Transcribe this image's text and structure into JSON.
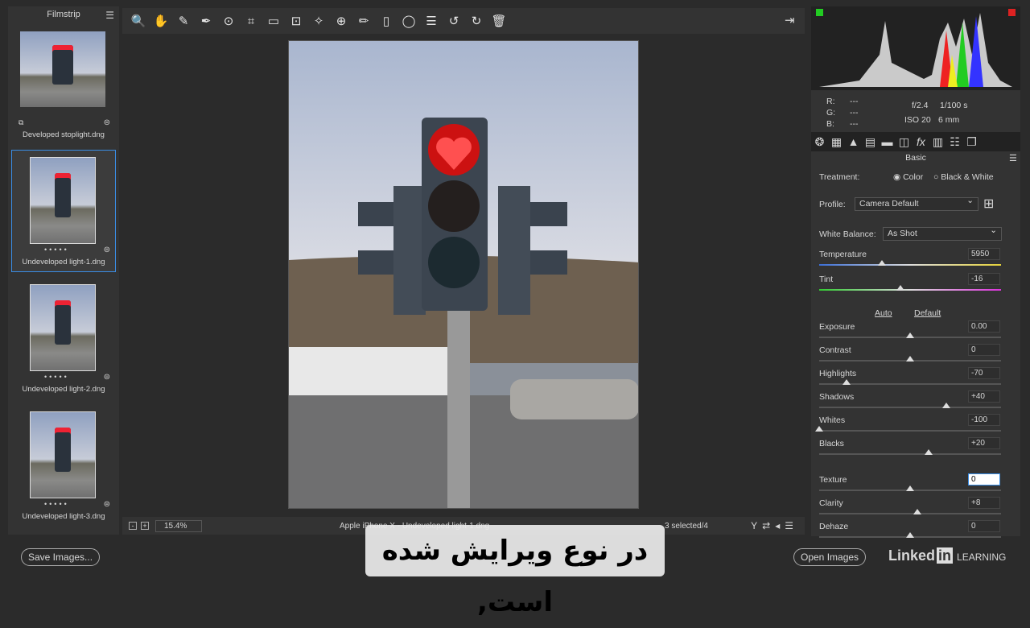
{
  "filmstrip": {
    "title": "Filmstrip",
    "items": [
      {
        "name": "Developed stoplight.dng",
        "selected": false
      },
      {
        "name": "Undeveloped light-1.dng",
        "selected": true
      },
      {
        "name": "Undeveloped light-2.dng",
        "selected": false
      },
      {
        "name": "Undeveloped light-3.dng",
        "selected": false
      }
    ]
  },
  "toolbar": {
    "tools": [
      "zoom-icon",
      "hand-icon",
      "white-balance-icon",
      "color-sampler-icon",
      "targeted-adjustment-icon",
      "crop-icon",
      "straighten-icon",
      "transform-icon",
      "spot-removal-icon",
      "red-eye-icon",
      "adjustment-brush-icon",
      "graduated-filter-icon",
      "radial-filter-icon",
      "presets-list-icon",
      "rotate-left-icon",
      "rotate-right-icon",
      "trash-icon"
    ],
    "glyphs": [
      "🔍",
      "✋",
      "✎",
      "✒",
      "⊙",
      "⌗",
      "▭",
      "⊡",
      "✧",
      "⊕",
      "✏",
      "▯",
      "◯",
      "☰",
      "↺",
      "↻",
      "🗑"
    ]
  },
  "status": {
    "zoom": "15.4%",
    "filename": "Apple iPhone X  -  Undeveloped light-1.dng",
    "selected": "3 selected/4"
  },
  "info": {
    "r_label": "R:",
    "g_label": "G:",
    "b_label": "B:",
    "r": "---",
    "g": "---",
    "b": "---",
    "aperture": "f/2.4",
    "shutter": "1/100 s",
    "iso": "ISO 20",
    "focal": "6 mm"
  },
  "panel": {
    "title": "Basic",
    "treatment_label": "Treatment:",
    "color": "Color",
    "bw": "Black & White",
    "treatment_value": "Color",
    "profile_label": "Profile:",
    "profile": "Camera Default",
    "wb_label": "White Balance:",
    "wb": "As Shot",
    "auto": "Auto",
    "default": "Default"
  },
  "sliders": [
    {
      "label": "Temperature",
      "value": "5950",
      "num": 5950,
      "min": 2000,
      "max": 50000
    },
    {
      "label": "Tint",
      "value": "-16",
      "num": -16,
      "min": -150,
      "max": 150
    },
    {
      "label": "Exposure",
      "value": "0.00",
      "num": 0,
      "min": -5,
      "max": 5
    },
    {
      "label": "Contrast",
      "value": "0",
      "num": 0,
      "min": -100,
      "max": 100
    },
    {
      "label": "Highlights",
      "value": "-70",
      "num": -70,
      "min": -100,
      "max": 100
    },
    {
      "label": "Shadows",
      "value": "+40",
      "num": 40,
      "min": -100,
      "max": 100
    },
    {
      "label": "Whites",
      "value": "-100",
      "num": -100,
      "min": -100,
      "max": 100
    },
    {
      "label": "Blacks",
      "value": "+20",
      "num": 20,
      "min": -100,
      "max": 100
    },
    {
      "label": "Texture",
      "value": "0",
      "num": 0,
      "min": -100,
      "max": 100
    },
    {
      "label": "Clarity",
      "value": "+8",
      "num": 8,
      "min": -100,
      "max": 100
    },
    {
      "label": "Dehaze",
      "value": "0",
      "num": 0,
      "min": -100,
      "max": 100
    }
  ],
  "bottom": {
    "save": "Save Images...",
    "open": "Open Images",
    "brand": "Linked",
    "brand_in": "in",
    "learning": "LEARNING"
  },
  "subtitle": "در نوع ویرایش شده است,"
}
